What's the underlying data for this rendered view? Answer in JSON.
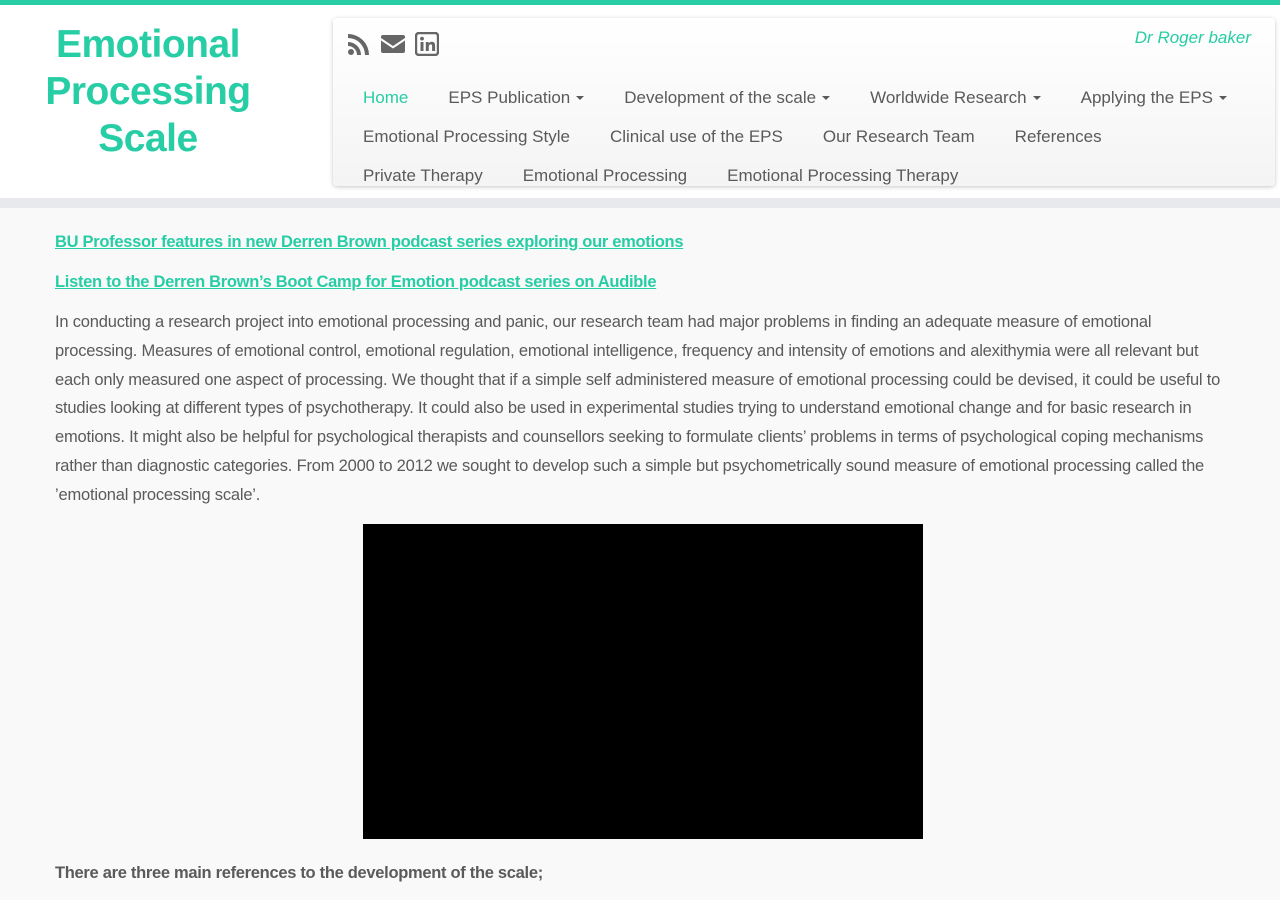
{
  "site": {
    "logo_line1": "Emotional",
    "logo_line2": "Processing Scale",
    "tagline": "Dr Roger baker",
    "accent_color": "#27cda5"
  },
  "social": [
    {
      "icon": "rss-icon"
    },
    {
      "icon": "envelope-icon"
    },
    {
      "icon": "linkedin-icon"
    }
  ],
  "nav": {
    "row1": [
      {
        "label": "Home",
        "active": true
      },
      {
        "label": "EPS Publication",
        "dropdown": true
      },
      {
        "label": "Development of the scale",
        "dropdown": true
      },
      {
        "label": "Worldwide Research",
        "dropdown": true
      },
      {
        "label": "Applying the EPS",
        "dropdown": true
      }
    ],
    "row2": [
      {
        "label": "Emotional Processing Style"
      },
      {
        "label": "Clinical use of the EPS"
      },
      {
        "label": "Our Research Team"
      },
      {
        "label": "References"
      }
    ],
    "row3": [
      {
        "label": "Private Therapy"
      },
      {
        "label": "Emotional Processing"
      },
      {
        "label": "Emotional Processing Therapy"
      }
    ]
  },
  "content": {
    "link1": "BU Professor features in new Derren Brown podcast series exploring our emotions",
    "link2": "Listen to the Derren Brown’s Boot Camp for Emotion podcast series on Audible",
    "intro": "In conducting a research project into emotional processing and panic, our research team had major problems in finding an adequate measure of emotional processing.  Measures of emotional control, emotional regulation, emotional intelligence, frequency and intensity of emotions and alexithymia were all relevant but each only measured one aspect of processing.  We thought that if a simple self administered measure of emotional processing could be devised, it could be useful to studies looking at different types of psychotherapy.  It could also be used in experimental studies trying to understand emotional change and for basic research in emotions.  It might also be helpful for psychological therapists and counsellors seeking to formulate clients’ problems in terms of psychological coping mechanisms rather than diagnostic categories.  From 2000 to 2012 we sought to develop such a simple but psychometrically sound measure of emotional processing called the ’emotional processing scale’.",
    "refs_title": "There are three main references to the development of the scale;"
  }
}
